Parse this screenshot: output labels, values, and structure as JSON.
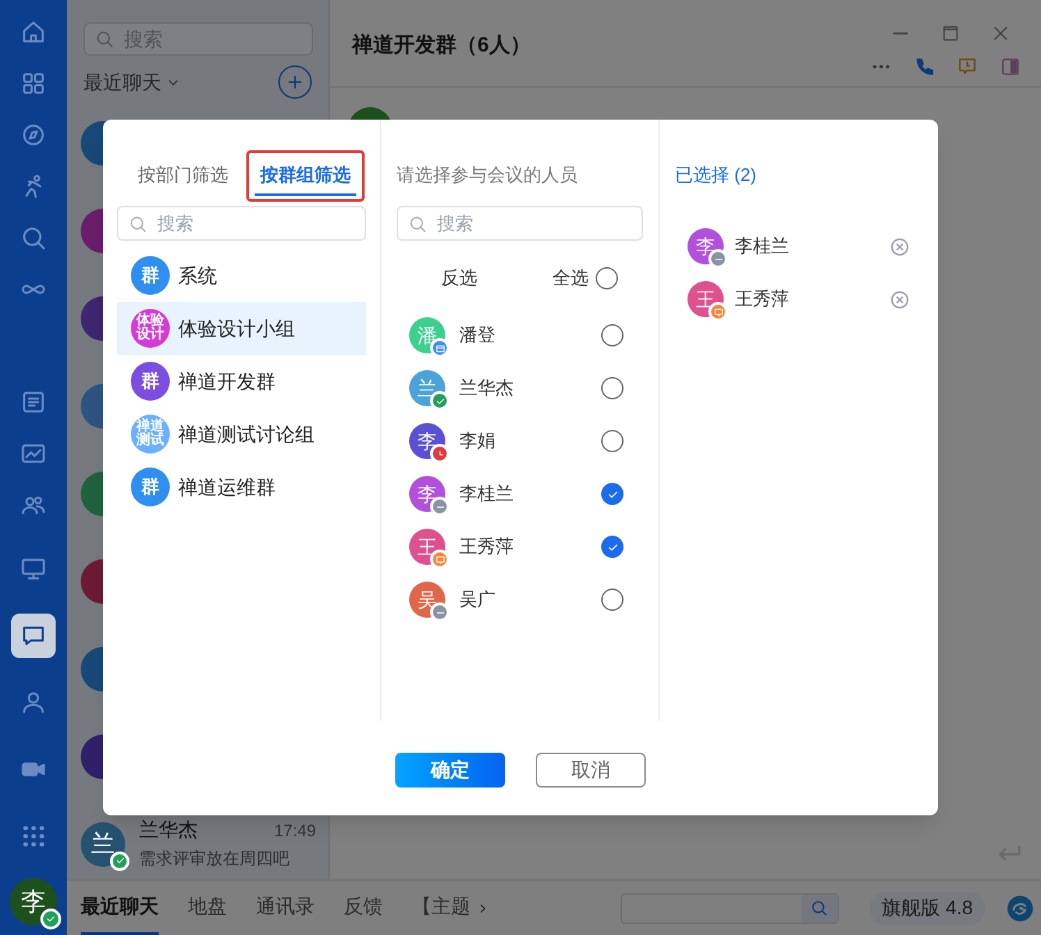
{
  "app_rail": {
    "items": [
      {
        "selected": false
      },
      {
        "selected": false
      },
      {
        "selected": false
      },
      {
        "selected": false
      },
      {
        "selected": false
      },
      {
        "selected": false
      },
      {
        "selected": false
      },
      {
        "selected": false
      },
      {
        "selected": false
      },
      {
        "selected": false
      },
      {
        "selected": true
      },
      {
        "selected": false
      },
      {
        "selected": false
      },
      {
        "selected": false
      }
    ],
    "user_avatar": {
      "text": "李",
      "color": "#1d501d",
      "badge": {
        "kind": "online"
      }
    }
  },
  "chat_list": {
    "search": {
      "placeholder": "搜索"
    },
    "filter": "最近聊天",
    "chats": [
      {
        "color": "#174878"
      },
      {
        "color": "#6b1d6b"
      },
      {
        "color": "#3e2670"
      },
      {
        "color": "#2d5480"
      },
      {
        "color": "#1e623e"
      },
      {
        "color": "#6d1a36"
      },
      {
        "color": "#174878"
      },
      {
        "color": "#2f2069"
      },
      {
        "color": "#265270",
        "avatar": "兰",
        "badge": {
          "kind": "online"
        },
        "name": "兰华杰",
        "time": "17:49",
        "preview": "需求评审放在周四吧"
      }
    ]
  },
  "chat": {
    "title": "禅道开发群（6人）"
  },
  "bottom_bar": {
    "tabs": [
      {
        "label": "最近聊天",
        "selected": true
      },
      {
        "label": "地盘",
        "selected": false
      },
      {
        "label": "通讯录",
        "selected": false
      },
      {
        "label": "反馈",
        "selected": false
      },
      {
        "label": "【主题",
        "selected": false
      }
    ],
    "edition": "旗舰版 4.8"
  },
  "dialog": {
    "filter_tabs": [
      {
        "label": "按部门筛选",
        "selected": false,
        "highlighted": false
      },
      {
        "label": "按群组筛选",
        "selected": true,
        "highlighted": true
      }
    ],
    "group_search": {
      "placeholder": "搜索"
    },
    "groups": [
      {
        "name": "系统",
        "avatar": "群",
        "color": "#2f8ff0",
        "selected": false
      },
      {
        "name": "体验设计小组",
        "avatar": "体验设计",
        "color": "#d63ad6",
        "selected": true
      },
      {
        "name": "禅道开发群",
        "avatar": "群",
        "color": "#7b4de0",
        "selected": false
      },
      {
        "name": "禅道测试讨论组",
        "avatar": "禅道测试",
        "color": "#6ab0ff",
        "selected": false
      },
      {
        "name": "禅道运维群",
        "avatar": "群",
        "color": "#2f8ff0",
        "selected": false
      }
    ],
    "people_title": "请选择参与会议的人员",
    "people_search": {
      "placeholder": "搜索"
    },
    "invert": "反选",
    "select_all": {
      "label": "全选",
      "checked": false
    },
    "people": [
      {
        "name": "潘登",
        "avatar": "潘",
        "color": "#3ccf8e",
        "badge": {
          "kind": "calendar"
        },
        "checked": false
      },
      {
        "name": "兰华杰",
        "avatar": "兰",
        "color": "#4ba3d8",
        "badge": {
          "kind": "online"
        },
        "checked": false
      },
      {
        "name": "李娟",
        "avatar": "李",
        "color": "#5b4fd6",
        "badge": {
          "kind": "busy"
        },
        "checked": false
      },
      {
        "name": "李桂兰",
        "avatar": "李",
        "color": "#b24fdc",
        "badge": {
          "kind": "away"
        },
        "checked": true
      },
      {
        "name": "王秀萍",
        "avatar": "王",
        "color": "#e0508f",
        "badge": {
          "kind": "meeting"
        },
        "checked": true
      },
      {
        "name": "吴广",
        "avatar": "吴",
        "color": "#e0684a",
        "badge": {
          "kind": "away"
        },
        "checked": false
      }
    ],
    "selected_title": "已选择 (2)",
    "selected_people": [
      {
        "name": "李桂兰",
        "avatar": "李",
        "color": "#b24fdc",
        "badge": {
          "kind": "away"
        }
      },
      {
        "name": "王秀萍",
        "avatar": "王",
        "color": "#e0508f",
        "badge": {
          "kind": "meeting"
        }
      }
    ],
    "buttons": [
      {
        "label": "确定",
        "kind": "primary"
      },
      {
        "label": "取消",
        "kind": "secondary"
      }
    ]
  }
}
